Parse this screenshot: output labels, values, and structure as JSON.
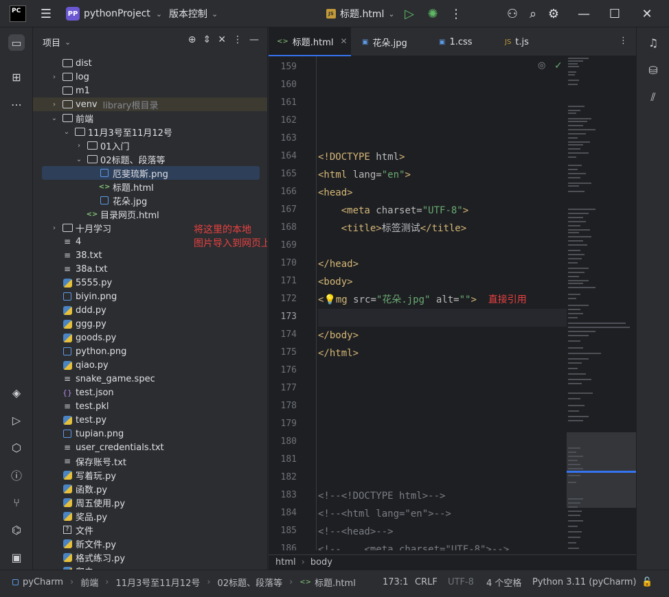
{
  "titlebar": {
    "logo": "PC",
    "project_badge": "PP",
    "project_name": "pythonProject",
    "vcs": "版本控制",
    "run_file": "标题.html"
  },
  "project_panel": {
    "title": "项目",
    "tree": [
      {
        "label": "dist",
        "kind": "folder",
        "level": 2,
        "arrow": ""
      },
      {
        "label": "log",
        "kind": "folder",
        "level": 2,
        "arrow": "›"
      },
      {
        "label": "m1",
        "kind": "folder",
        "level": 2,
        "arrow": ""
      },
      {
        "label": "venv",
        "kind": "folder",
        "level": 2,
        "arrow": "›",
        "extra": "library根目录"
      },
      {
        "label": "前端",
        "kind": "folder",
        "level": 2,
        "arrow": "⌄"
      },
      {
        "label": "11月3号至11月12号",
        "kind": "folder",
        "level": 3,
        "arrow": "⌄"
      },
      {
        "label": "01入门",
        "kind": "folder",
        "level": 4,
        "arrow": "›"
      },
      {
        "label": "02标题、段落等",
        "kind": "folder",
        "level": 4,
        "arrow": "⌄"
      },
      {
        "label": "厄斐琉斯.png",
        "kind": "png",
        "level": 5,
        "arrow": ""
      },
      {
        "label": "标题.html",
        "kind": "html",
        "level": 5,
        "arrow": ""
      },
      {
        "label": "花朵.jpg",
        "kind": "png",
        "level": 5,
        "arrow": ""
      },
      {
        "label": "目录网页.html",
        "kind": "html",
        "level": 4,
        "arrow": ""
      },
      {
        "label": "十月学习",
        "kind": "folder",
        "level": 2,
        "arrow": "›"
      },
      {
        "label": "4",
        "kind": "txt",
        "level": 2,
        "arrow": ""
      },
      {
        "label": "38.txt",
        "kind": "txt",
        "level": 2,
        "arrow": ""
      },
      {
        "label": "38a.txt",
        "kind": "txt",
        "level": 2,
        "arrow": ""
      },
      {
        "label": "5555.py",
        "kind": "py",
        "level": 2,
        "arrow": ""
      },
      {
        "label": "biyin.png",
        "kind": "png",
        "level": 2,
        "arrow": ""
      },
      {
        "label": "ddd.py",
        "kind": "py",
        "level": 2,
        "arrow": ""
      },
      {
        "label": "ggg.py",
        "kind": "py",
        "level": 2,
        "arrow": ""
      },
      {
        "label": "goods.py",
        "kind": "py",
        "level": 2,
        "arrow": ""
      },
      {
        "label": "python.png",
        "kind": "png",
        "level": 2,
        "arrow": ""
      },
      {
        "label": "qiao.py",
        "kind": "py",
        "level": 2,
        "arrow": ""
      },
      {
        "label": "snake_game.spec",
        "kind": "txt",
        "level": 2,
        "arrow": ""
      },
      {
        "label": "test.json",
        "kind": "json",
        "level": 2,
        "arrow": ""
      },
      {
        "label": "test.pkl",
        "kind": "txt",
        "level": 2,
        "arrow": ""
      },
      {
        "label": "test.py",
        "kind": "py",
        "level": 2,
        "arrow": ""
      },
      {
        "label": "tupian.png",
        "kind": "png",
        "level": 2,
        "arrow": ""
      },
      {
        "label": "user_credentials.txt",
        "kind": "txt",
        "level": 2,
        "arrow": ""
      },
      {
        "label": "保存账号.txt",
        "kind": "txt",
        "level": 2,
        "arrow": ""
      },
      {
        "label": "写着玩.py",
        "kind": "py",
        "level": 2,
        "arrow": ""
      },
      {
        "label": "函数.py",
        "kind": "py",
        "level": 2,
        "arrow": ""
      },
      {
        "label": "周五使用.py",
        "kind": "py",
        "level": 2,
        "arrow": ""
      },
      {
        "label": "奖品.py",
        "kind": "py",
        "level": 2,
        "arrow": ""
      },
      {
        "label": "文件",
        "kind": "unknown",
        "level": 2,
        "arrow": ""
      },
      {
        "label": "新文件.py",
        "kind": "py",
        "level": 2,
        "arrow": ""
      },
      {
        "label": "格式练习.py",
        "kind": "py",
        "level": 2,
        "arrow": ""
      },
      {
        "label": "爬虫.py",
        "kind": "py",
        "level": 2,
        "arrow": ""
      }
    ],
    "annotation": "将这里的本地\n图片导入到网页上"
  },
  "editor": {
    "tabs": [
      {
        "label": "标题.html",
        "icon": "html",
        "active": true
      },
      {
        "label": "花朵.jpg",
        "icon": "png",
        "active": false
      },
      {
        "label": "1.css",
        "icon": "css",
        "active": false
      },
      {
        "label": "t.js",
        "icon": "js",
        "active": false
      }
    ],
    "lines": [
      {
        "n": "159",
        "code": []
      },
      {
        "n": "160",
        "code": []
      },
      {
        "n": "161",
        "code": []
      },
      {
        "n": "162",
        "code": []
      },
      {
        "n": "163",
        "code": []
      },
      {
        "n": "164",
        "code": [
          [
            "tag",
            "<!DOCTYPE "
          ],
          [
            "txt",
            "html"
          ],
          [
            "tag",
            ">"
          ]
        ]
      },
      {
        "n": "165",
        "code": [
          [
            "tag",
            "<html "
          ],
          [
            "attr",
            "lang="
          ],
          [
            "str",
            "\"en\""
          ],
          [
            "tag",
            ">"
          ]
        ]
      },
      {
        "n": "166",
        "code": [
          [
            "tag",
            "<head>"
          ]
        ]
      },
      {
        "n": "167",
        "code": [
          [
            "txt",
            "    "
          ],
          [
            "tag",
            "<meta "
          ],
          [
            "attr",
            "charset="
          ],
          [
            "str",
            "\"UTF-8\""
          ],
          [
            "tag",
            ">"
          ]
        ]
      },
      {
        "n": "168",
        "code": [
          [
            "txt",
            "    "
          ],
          [
            "tag",
            "<title>"
          ],
          [
            "txt",
            "标签测试"
          ],
          [
            "tag",
            "</title>"
          ]
        ]
      },
      {
        "n": "169",
        "code": []
      },
      {
        "n": "170",
        "code": [
          [
            "tag",
            "</head>"
          ]
        ]
      },
      {
        "n": "171",
        "code": [
          [
            "tag",
            "<body>"
          ]
        ]
      },
      {
        "n": "172",
        "code": [
          [
            "tag",
            "<"
          ],
          [
            "bulb",
            "💡"
          ],
          [
            "tag",
            "mg "
          ],
          [
            "attr",
            "src="
          ],
          [
            "str",
            "\"花朵.jpg\""
          ],
          [
            "attr",
            " alt="
          ],
          [
            "str",
            "\"\""
          ],
          [
            "tag",
            ">"
          ],
          [
            "txt",
            "  "
          ],
          [
            "annot2",
            "直接引用"
          ]
        ]
      },
      {
        "n": "173",
        "code": [],
        "current": true
      },
      {
        "n": "174",
        "code": [
          [
            "tag",
            "</body>"
          ]
        ]
      },
      {
        "n": "175",
        "code": [
          [
            "tag",
            "</html>"
          ]
        ]
      },
      {
        "n": "176",
        "code": []
      },
      {
        "n": "177",
        "code": []
      },
      {
        "n": "178",
        "code": []
      },
      {
        "n": "179",
        "code": []
      },
      {
        "n": "180",
        "code": []
      },
      {
        "n": "181",
        "code": []
      },
      {
        "n": "182",
        "code": []
      },
      {
        "n": "183",
        "code": [
          [
            "cmt",
            "<!--<!DOCTYPE html>-->"
          ]
        ]
      },
      {
        "n": "184",
        "code": [
          [
            "cmt",
            "<!--<html lang=\"en\">-->"
          ]
        ]
      },
      {
        "n": "185",
        "code": [
          [
            "cmt",
            "<!--<head>-->"
          ]
        ]
      },
      {
        "n": "186",
        "code": [
          [
            "cmt",
            "<!--    <meta charset=\"UTF-8\">-->"
          ]
        ]
      }
    ],
    "breadcrumb": [
      "html",
      "body"
    ]
  },
  "statusbar": {
    "path": [
      "pyCharm",
      "前端",
      "11月3号至11月12号",
      "02标题、段落等",
      "标题.html"
    ],
    "position": "173:1",
    "line_sep": "CRLF",
    "encoding": "UTF-8",
    "indent": "4 个空格",
    "interpreter": "Python 3.11 (pyCharm)"
  },
  "colors": {
    "accent": "#3574f0",
    "annotation": "#e84141",
    "tag": "#d5b778",
    "string": "#6aab73"
  }
}
